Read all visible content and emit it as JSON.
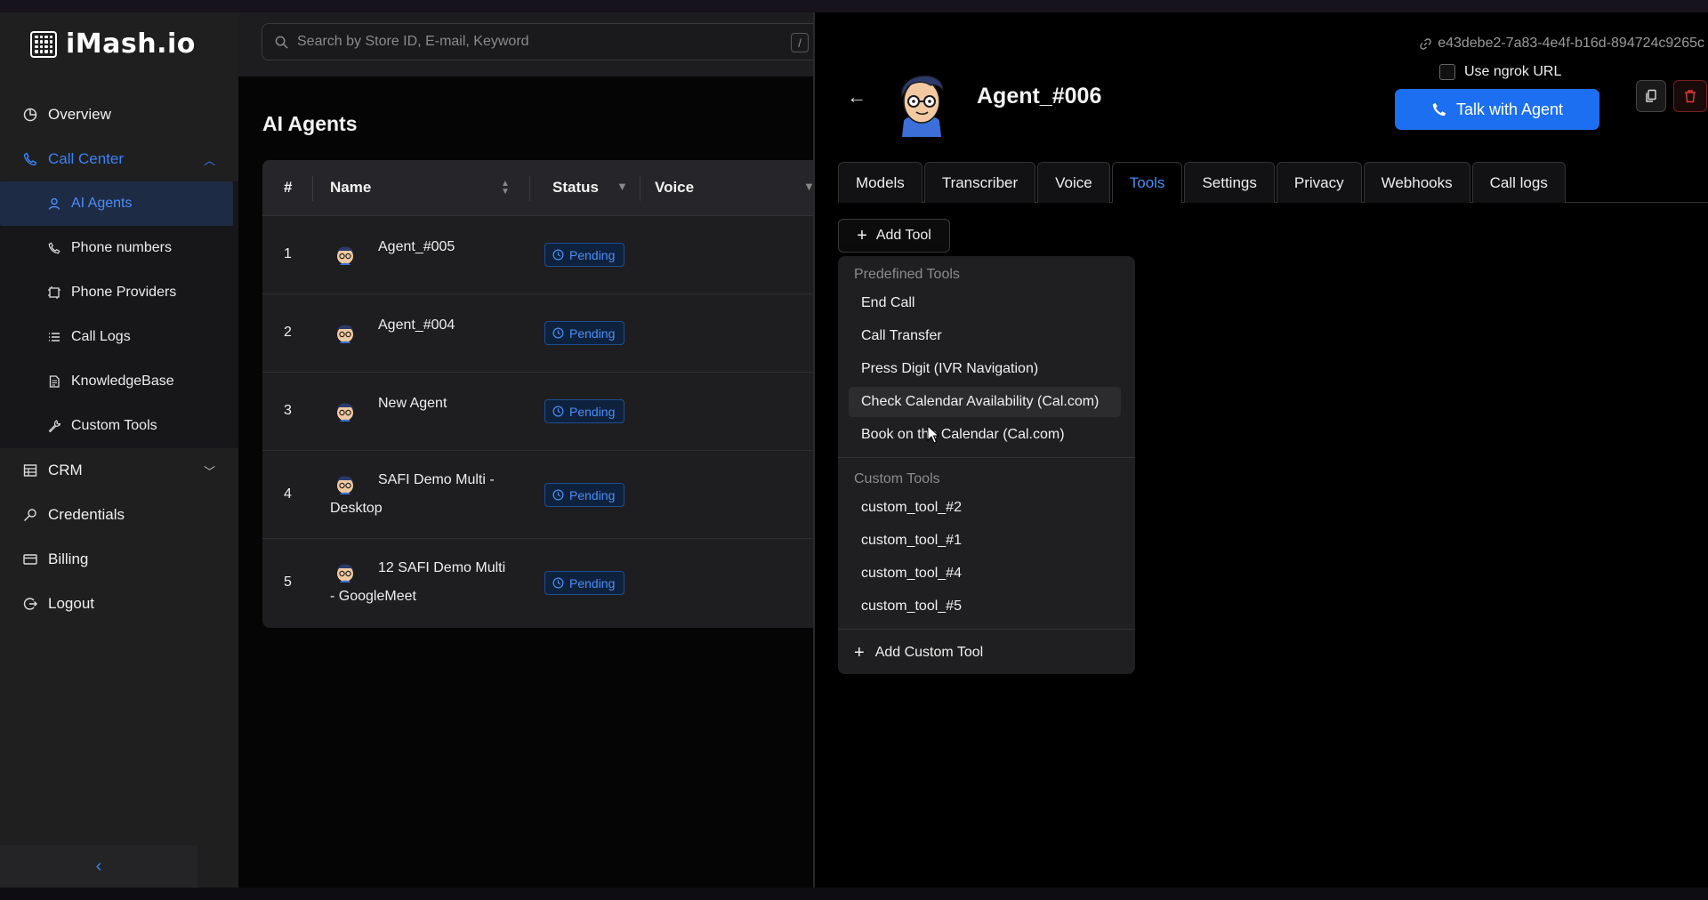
{
  "app": {
    "name": "iMash.io"
  },
  "sidebar": {
    "items": [
      {
        "label": "Overview",
        "icon": "pie-chart-icon"
      },
      {
        "label": "Call Center",
        "icon": "phone-icon",
        "expanded": true
      },
      {
        "label": "CRM",
        "icon": "table-icon",
        "expanded": false
      },
      {
        "label": "Credentials",
        "icon": "key-icon"
      },
      {
        "label": "Billing",
        "icon": "card-icon"
      },
      {
        "label": "Logout",
        "icon": "logout-icon"
      }
    ],
    "sub_items": [
      {
        "label": "AI Agents",
        "icon": "user-icon",
        "active": true
      },
      {
        "label": "Phone numbers",
        "icon": "phone-icon"
      },
      {
        "label": "Phone Providers",
        "icon": "provider-icon"
      },
      {
        "label": "Call Logs",
        "icon": "list-icon"
      },
      {
        "label": "KnowledgeBase",
        "icon": "document-icon"
      },
      {
        "label": "Custom Tools",
        "icon": "wrench-icon"
      }
    ],
    "collapse_icon": "chevron-left-icon"
  },
  "search": {
    "placeholder": "Search by Store ID, E-mail, Keyword",
    "shortcut": "/"
  },
  "list": {
    "title": "AI Agents",
    "columns": {
      "num": "#",
      "name": "Name",
      "status": "Status",
      "voice": "Voice"
    },
    "rows": [
      {
        "num": "1",
        "name": "Agent_#005",
        "status": "Pending"
      },
      {
        "num": "2",
        "name": "Agent_#004",
        "status": "Pending"
      },
      {
        "num": "3",
        "name": "New Agent",
        "status": "Pending"
      },
      {
        "num": "4",
        "name": "SAFI Demo Multi -",
        "name2": "Desktop",
        "status": "Pending"
      },
      {
        "num": "5",
        "name": "12 SAFI Demo Multi",
        "name2": "- GoogleMeet",
        "status": "Pending"
      }
    ]
  },
  "detail": {
    "agent_id": "e43debe2-7a83-4e4f-b16d-894724c9265c",
    "agent_name": "Agent_#006",
    "ngrok_label": "Use ngrok URL",
    "talk_label": "Talk with Agent",
    "tabs": [
      "Models",
      "Transcriber",
      "Voice",
      "Tools",
      "Settings",
      "Privacy",
      "Webhooks",
      "Call logs"
    ],
    "active_tab": "Tools",
    "add_tool_label": "Add Tool",
    "dropdown": {
      "predefined_header": "Predefined Tools",
      "predefined": [
        "End Call",
        "Call Transfer",
        "Press Digit (IVR Navigation)",
        "Check Calendar Availability (Cal.com)",
        "Book on the Calendar (Cal.com)"
      ],
      "hovered": "Check Calendar Availability (Cal.com)",
      "custom_header": "Custom Tools",
      "custom": [
        "custom_tool_#2",
        "custom_tool_#1",
        "custom_tool_#4",
        "custom_tool_#5"
      ],
      "add_custom_label": "Add Custom Tool"
    }
  },
  "colors": {
    "accent": "#1d6ff2",
    "link": "#4a8df8",
    "danger": "#e53935"
  }
}
